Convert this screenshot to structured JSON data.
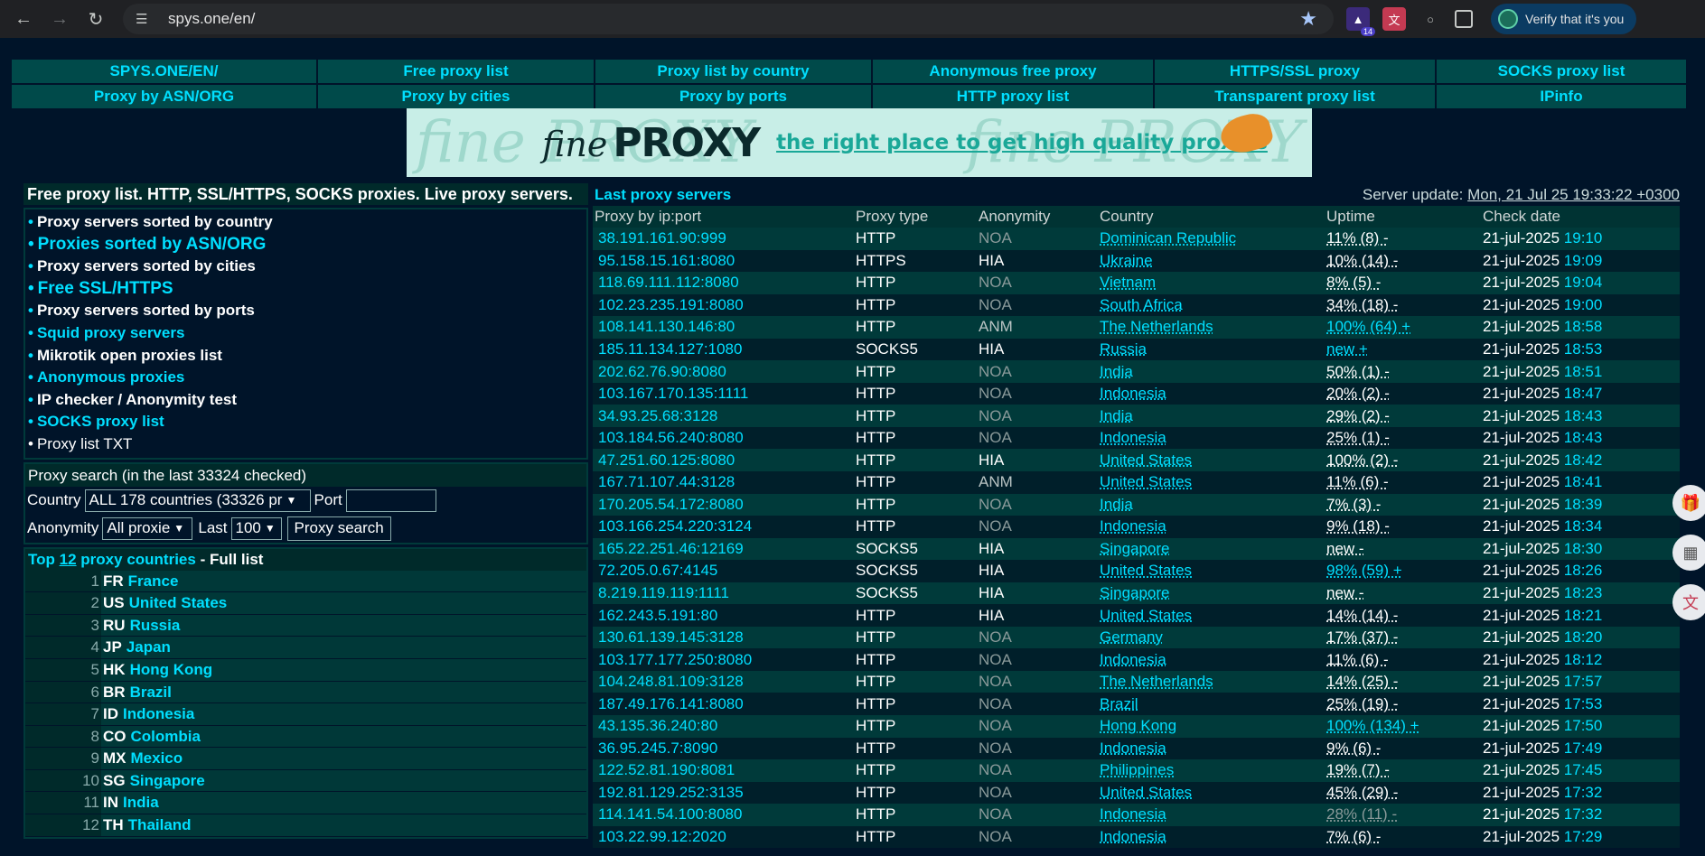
{
  "browser": {
    "url": "spys.one/en/",
    "verify_label": "Verify that it's you",
    "ext_badge": "14"
  },
  "menu": {
    "row1": [
      "SPYS.ONE/EN/",
      "Free proxy list",
      "Proxy list by country",
      "Anonymous free proxy",
      "HTTPS/SSL proxy",
      "SOCKS proxy list"
    ],
    "row2": [
      "Proxy by ASN/ORG",
      "Proxy by cities",
      "Proxy by ports",
      "HTTP proxy list",
      "Transparent proxy list",
      "IPinfo"
    ]
  },
  "banner": {
    "fine": "fine",
    "proxy": "PROXY",
    "tagline": "the right place to get high quality proxies",
    "ghost_left": "fine PROXY",
    "ghost_right": "fine PROXY"
  },
  "left": {
    "title": "Free proxy list. HTTP, SSL/HTTPS, SOCKS proxies. Live proxy servers.",
    "links": [
      "Proxy servers sorted by country",
      "Proxies sorted by ASN/ORG",
      "Proxy servers sorted by cities",
      "Free SSL/HTTPS",
      "Proxy servers sorted by ports",
      "Squid proxy servers",
      "Mikrotik open proxies list",
      "Anonymous proxies",
      "IP checker / Anonymity test",
      "SOCKS proxy list",
      "Proxy list TXT"
    ],
    "search": {
      "header": "Proxy search (in the last 33324 checked)",
      "country_label": "Country",
      "country_value": "ALL 178 countries (33326 pr",
      "port_label": "Port",
      "anonymity_label": "Anonymity",
      "anonymity_value": "All proxie",
      "last_label": "Last",
      "last_value": "100",
      "button": "Proxy search"
    },
    "top": {
      "prefix": "Top",
      "count": "12",
      "mid": "proxy countries",
      "suffix": "- Full list",
      "rows": [
        {
          "n": "1",
          "cc": "FR",
          "name": "France"
        },
        {
          "n": "2",
          "cc": "US",
          "name": "United States"
        },
        {
          "n": "3",
          "cc": "RU",
          "name": "Russia"
        },
        {
          "n": "4",
          "cc": "JP",
          "name": "Japan"
        },
        {
          "n": "5",
          "cc": "HK",
          "name": "Hong Kong"
        },
        {
          "n": "6",
          "cc": "BR",
          "name": "Brazil"
        },
        {
          "n": "7",
          "cc": "ID",
          "name": "Indonesia"
        },
        {
          "n": "8",
          "cc": "CO",
          "name": "Colombia"
        },
        {
          "n": "9",
          "cc": "MX",
          "name": "Mexico"
        },
        {
          "n": "10",
          "cc": "SG",
          "name": "Singapore"
        },
        {
          "n": "11",
          "cc": "IN",
          "name": "India"
        },
        {
          "n": "12",
          "cc": "TH",
          "name": "Thailand"
        }
      ]
    }
  },
  "right": {
    "title": "Last proxy servers",
    "server_update_label": "Server update:",
    "server_update_value": "Mon, 21 Jul 25 19:33:22 +0300",
    "columns": [
      "Proxy by ip:port",
      "Proxy type",
      "Anonymity",
      "Country",
      "Uptime",
      "Check date"
    ],
    "rows": [
      {
        "ip": "38.191.161.90:999",
        "type": "HTTP",
        "anon": "NOA",
        "country": "Dominican Republic",
        "uptime": "11% (8) -",
        "date": "21-jul-2025",
        "time": "19:10"
      },
      {
        "ip": "95.158.15.161:8080",
        "type": "HTTPS",
        "anon": "HIA",
        "country": "Ukraine",
        "uptime": "10% (14) -",
        "date": "21-jul-2025",
        "time": "19:09"
      },
      {
        "ip": "118.69.111.112:8080",
        "type": "HTTP",
        "anon": "NOA",
        "country": "Vietnam",
        "uptime": "8% (5) -",
        "date": "21-jul-2025",
        "time": "19:04"
      },
      {
        "ip": "102.23.235.191:8080",
        "type": "HTTP",
        "anon": "NOA",
        "country": "South Africa",
        "uptime": "34% (18) -",
        "date": "21-jul-2025",
        "time": "19:00"
      },
      {
        "ip": "108.141.130.146:80",
        "type": "HTTP",
        "anon": "ANM",
        "country": "The Netherlands",
        "uptime": "100% (64) +",
        "date": "21-jul-2025",
        "time": "18:58"
      },
      {
        "ip": "185.11.134.127:1080",
        "type": "SOCKS5",
        "anon": "HIA",
        "country": "Russia",
        "uptime": "new +",
        "date": "21-jul-2025",
        "time": "18:53"
      },
      {
        "ip": "202.62.76.90:8080",
        "type": "HTTP",
        "anon": "NOA",
        "country": "India",
        "uptime": "50% (1) -",
        "date": "21-jul-2025",
        "time": "18:51"
      },
      {
        "ip": "103.167.170.135:1111",
        "type": "HTTP",
        "anon": "NOA",
        "country": "Indonesia",
        "uptime": "20% (2) -",
        "date": "21-jul-2025",
        "time": "18:47"
      },
      {
        "ip": "34.93.25.68:3128",
        "type": "HTTP",
        "anon": "NOA",
        "country": "India",
        "uptime": "29% (2) -",
        "date": "21-jul-2025",
        "time": "18:43"
      },
      {
        "ip": "103.184.56.240:8080",
        "type": "HTTP",
        "anon": "NOA",
        "country": "Indonesia",
        "uptime": "25% (1) -",
        "date": "21-jul-2025",
        "time": "18:43"
      },
      {
        "ip": "47.251.60.125:8080",
        "type": "HTTP",
        "anon": "HIA",
        "country": "United States",
        "uptime": "100% (2) -",
        "date": "21-jul-2025",
        "time": "18:42"
      },
      {
        "ip": "167.71.107.44:3128",
        "type": "HTTP",
        "anon": "ANM",
        "country": "United States",
        "uptime": "11% (6) -",
        "date": "21-jul-2025",
        "time": "18:41"
      },
      {
        "ip": "170.205.54.172:8080",
        "type": "HTTP",
        "anon": "NOA",
        "country": "India",
        "uptime": "7% (3) -",
        "date": "21-jul-2025",
        "time": "18:39"
      },
      {
        "ip": "103.166.254.220:3124",
        "type": "HTTP",
        "anon": "NOA",
        "country": "Indonesia",
        "uptime": "9% (18) -",
        "date": "21-jul-2025",
        "time": "18:34"
      },
      {
        "ip": "165.22.251.46:12169",
        "type": "SOCKS5",
        "anon": "HIA",
        "country": "Singapore",
        "uptime": "new -",
        "date": "21-jul-2025",
        "time": "18:30"
      },
      {
        "ip": "72.205.0.67:4145",
        "type": "SOCKS5",
        "anon": "HIA",
        "country": "United States",
        "uptime": "98% (59) +",
        "date": "21-jul-2025",
        "time": "18:26"
      },
      {
        "ip": "8.219.119.119:1111",
        "type": "SOCKS5",
        "anon": "HIA",
        "country": "Singapore",
        "uptime": "new -",
        "date": "21-jul-2025",
        "time": "18:23"
      },
      {
        "ip": "162.243.5.191:80",
        "type": "HTTP",
        "anon": "HIA",
        "country": "United States",
        "uptime": "14% (14) -",
        "date": "21-jul-2025",
        "time": "18:21"
      },
      {
        "ip": "130.61.139.145:3128",
        "type": "HTTP",
        "anon": "NOA",
        "country": "Germany",
        "uptime": "17% (37) -",
        "date": "21-jul-2025",
        "time": "18:20"
      },
      {
        "ip": "103.177.177.250:8080",
        "type": "HTTP",
        "anon": "NOA",
        "country": "Indonesia",
        "uptime": "11% (6) -",
        "date": "21-jul-2025",
        "time": "18:12"
      },
      {
        "ip": "104.248.81.109:3128",
        "type": "HTTP",
        "anon": "NOA",
        "country": "The Netherlands",
        "uptime": "14% (25) -",
        "date": "21-jul-2025",
        "time": "17:57"
      },
      {
        "ip": "187.49.176.141:8080",
        "type": "HTTP",
        "anon": "NOA",
        "country": "Brazil",
        "uptime": "25% (19) -",
        "date": "21-jul-2025",
        "time": "17:53"
      },
      {
        "ip": "43.135.36.240:80",
        "type": "HTTP",
        "anon": "NOA",
        "country": "Hong Kong",
        "uptime": "100% (134) +",
        "date": "21-jul-2025",
        "time": "17:50"
      },
      {
        "ip": "36.95.245.7:8090",
        "type": "HTTP",
        "anon": "NOA",
        "country": "Indonesia",
        "uptime": "9% (6) -",
        "date": "21-jul-2025",
        "time": "17:49"
      },
      {
        "ip": "122.52.81.190:8081",
        "type": "HTTP",
        "anon": "NOA",
        "country": "Philippines",
        "uptime": "19% (7) -",
        "date": "21-jul-2025",
        "time": "17:45"
      },
      {
        "ip": "192.81.129.252:3135",
        "type": "HTTP",
        "anon": "NOA",
        "country": "United States",
        "uptime": "45% (29) -",
        "date": "21-jul-2025",
        "time": "17:32"
      },
      {
        "ip": "114.141.54.100:8080",
        "type": "HTTP",
        "anon": "NOA",
        "country": "Indonesia",
        "uptime": "28% (11) -",
        "date": "21-jul-2025",
        "time": "17:32"
      },
      {
        "ip": "103.22.99.12:2020",
        "type": "HTTP",
        "anon": "NOA",
        "country": "Indonesia",
        "uptime": "7% (6) -",
        "date": "21-jul-2025",
        "time": "17:29"
      }
    ]
  },
  "colors": {
    "accent": "#00dfff",
    "background": "#001429",
    "row": "#003a3a"
  },
  "side_buttons": [
    "gift-icon",
    "apps-icon",
    "translate-icon"
  ]
}
